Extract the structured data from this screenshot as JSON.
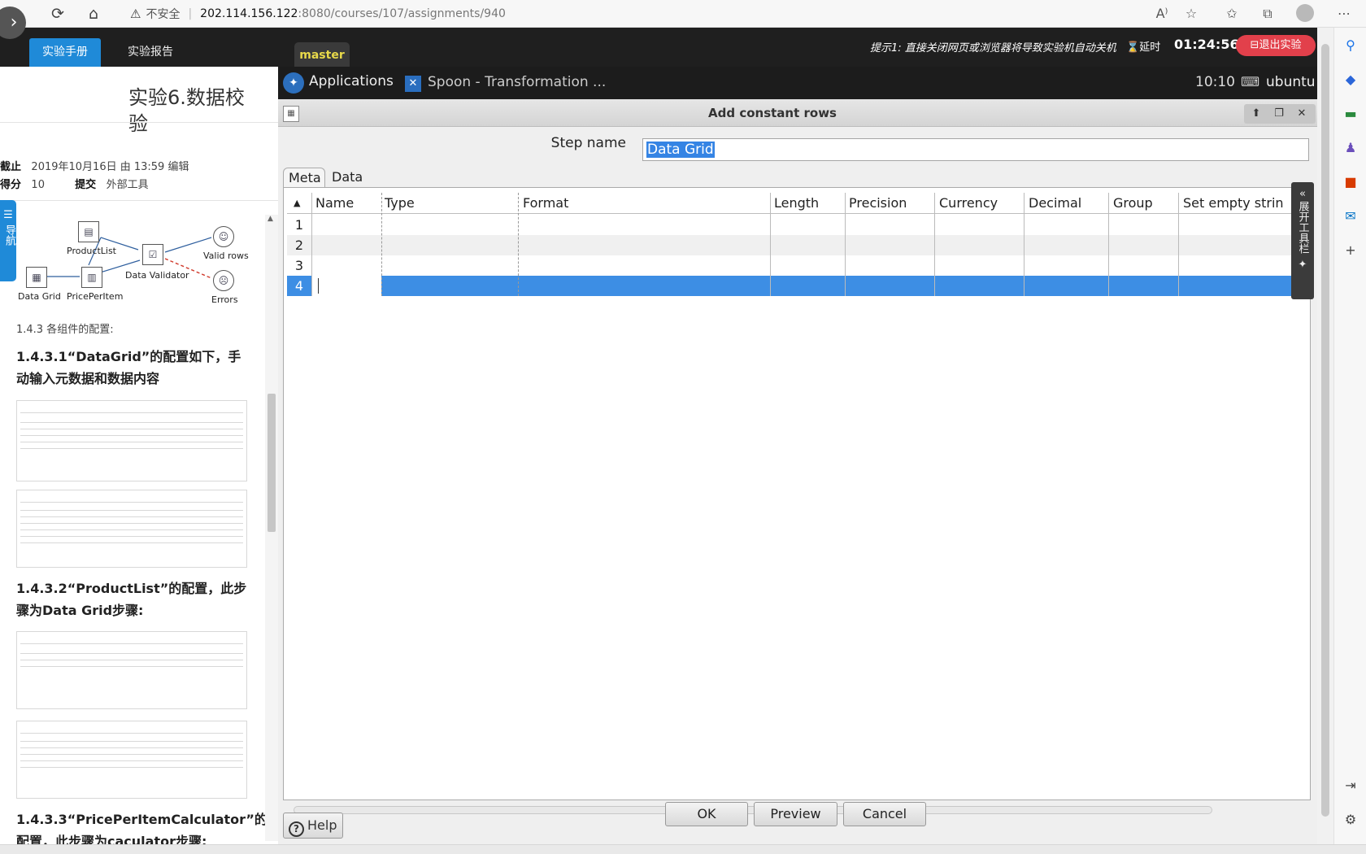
{
  "browser": {
    "url_warning": "不安全",
    "url_host": "202.114.156.122",
    "url_path": ":8080/courses/107/assignments/940"
  },
  "lab_bar": {
    "tab_manual": "实验手册",
    "tab_report": "实验报告",
    "branch": "master",
    "hint": "提示1: 直接关闭网页或浏览器将导致实验机自动关机",
    "delay": "延时",
    "timer": "01:24:56",
    "exit": "退出实验"
  },
  "doc": {
    "title": "实验6.数据校验",
    "deadline_label": "截止",
    "deadline_value": "2019年10月16日 由 13:59 编辑",
    "score_label": "得分",
    "score_value": "10",
    "submit_label": "提交",
    "submit_value": "外部工具",
    "nav_tab": "导航",
    "flow": {
      "product_list": "ProductList",
      "data_validator": "Data Validator",
      "valid_rows": "Valid rows",
      "data_grid": "Data Grid",
      "price_per_item": "PricePerItem",
      "errors": "Errors"
    },
    "sec_config": "1.4.3 各组件的配置:",
    "sec_datagrid": "1.4.3.1“DataGrid”的配置如下，手动输入元数据和数据内容",
    "sec_productlist": "1.4.3.2“ProductList”的配置，此步骤为Data Grid步骤:",
    "sec_priceperitem": "1.4.3.3“PricePerItemCalculator”的配置，此步骤为caculator步骤:"
  },
  "vm_bar": {
    "applications": "Applications",
    "window_title": "Spoon - Transformation ...",
    "clock": "10:10",
    "user": "ubuntu"
  },
  "dialog": {
    "title": "Add constant rows",
    "step_name_label": "Step name",
    "step_name_value": "Data Grid",
    "tab_meta": "Meta",
    "tab_data": "Data",
    "columns": [
      "Name",
      "Type",
      "Format",
      "Length",
      "Precision",
      "Currency",
      "Decimal",
      "Group",
      "Set empty strin"
    ],
    "rows": [
      "1",
      "2",
      "3",
      "4"
    ],
    "selected_row": "4",
    "buttons": {
      "ok": "OK",
      "preview": "Preview",
      "cancel": "Cancel",
      "help": "Help"
    },
    "side_toolbar": "展开工具栏"
  },
  "colors": {
    "accent_blue": "#1f8ad8",
    "selection_blue": "#3d8ee4",
    "exit_red": "#e2404b",
    "branch_yellow": "#e8d94a"
  }
}
